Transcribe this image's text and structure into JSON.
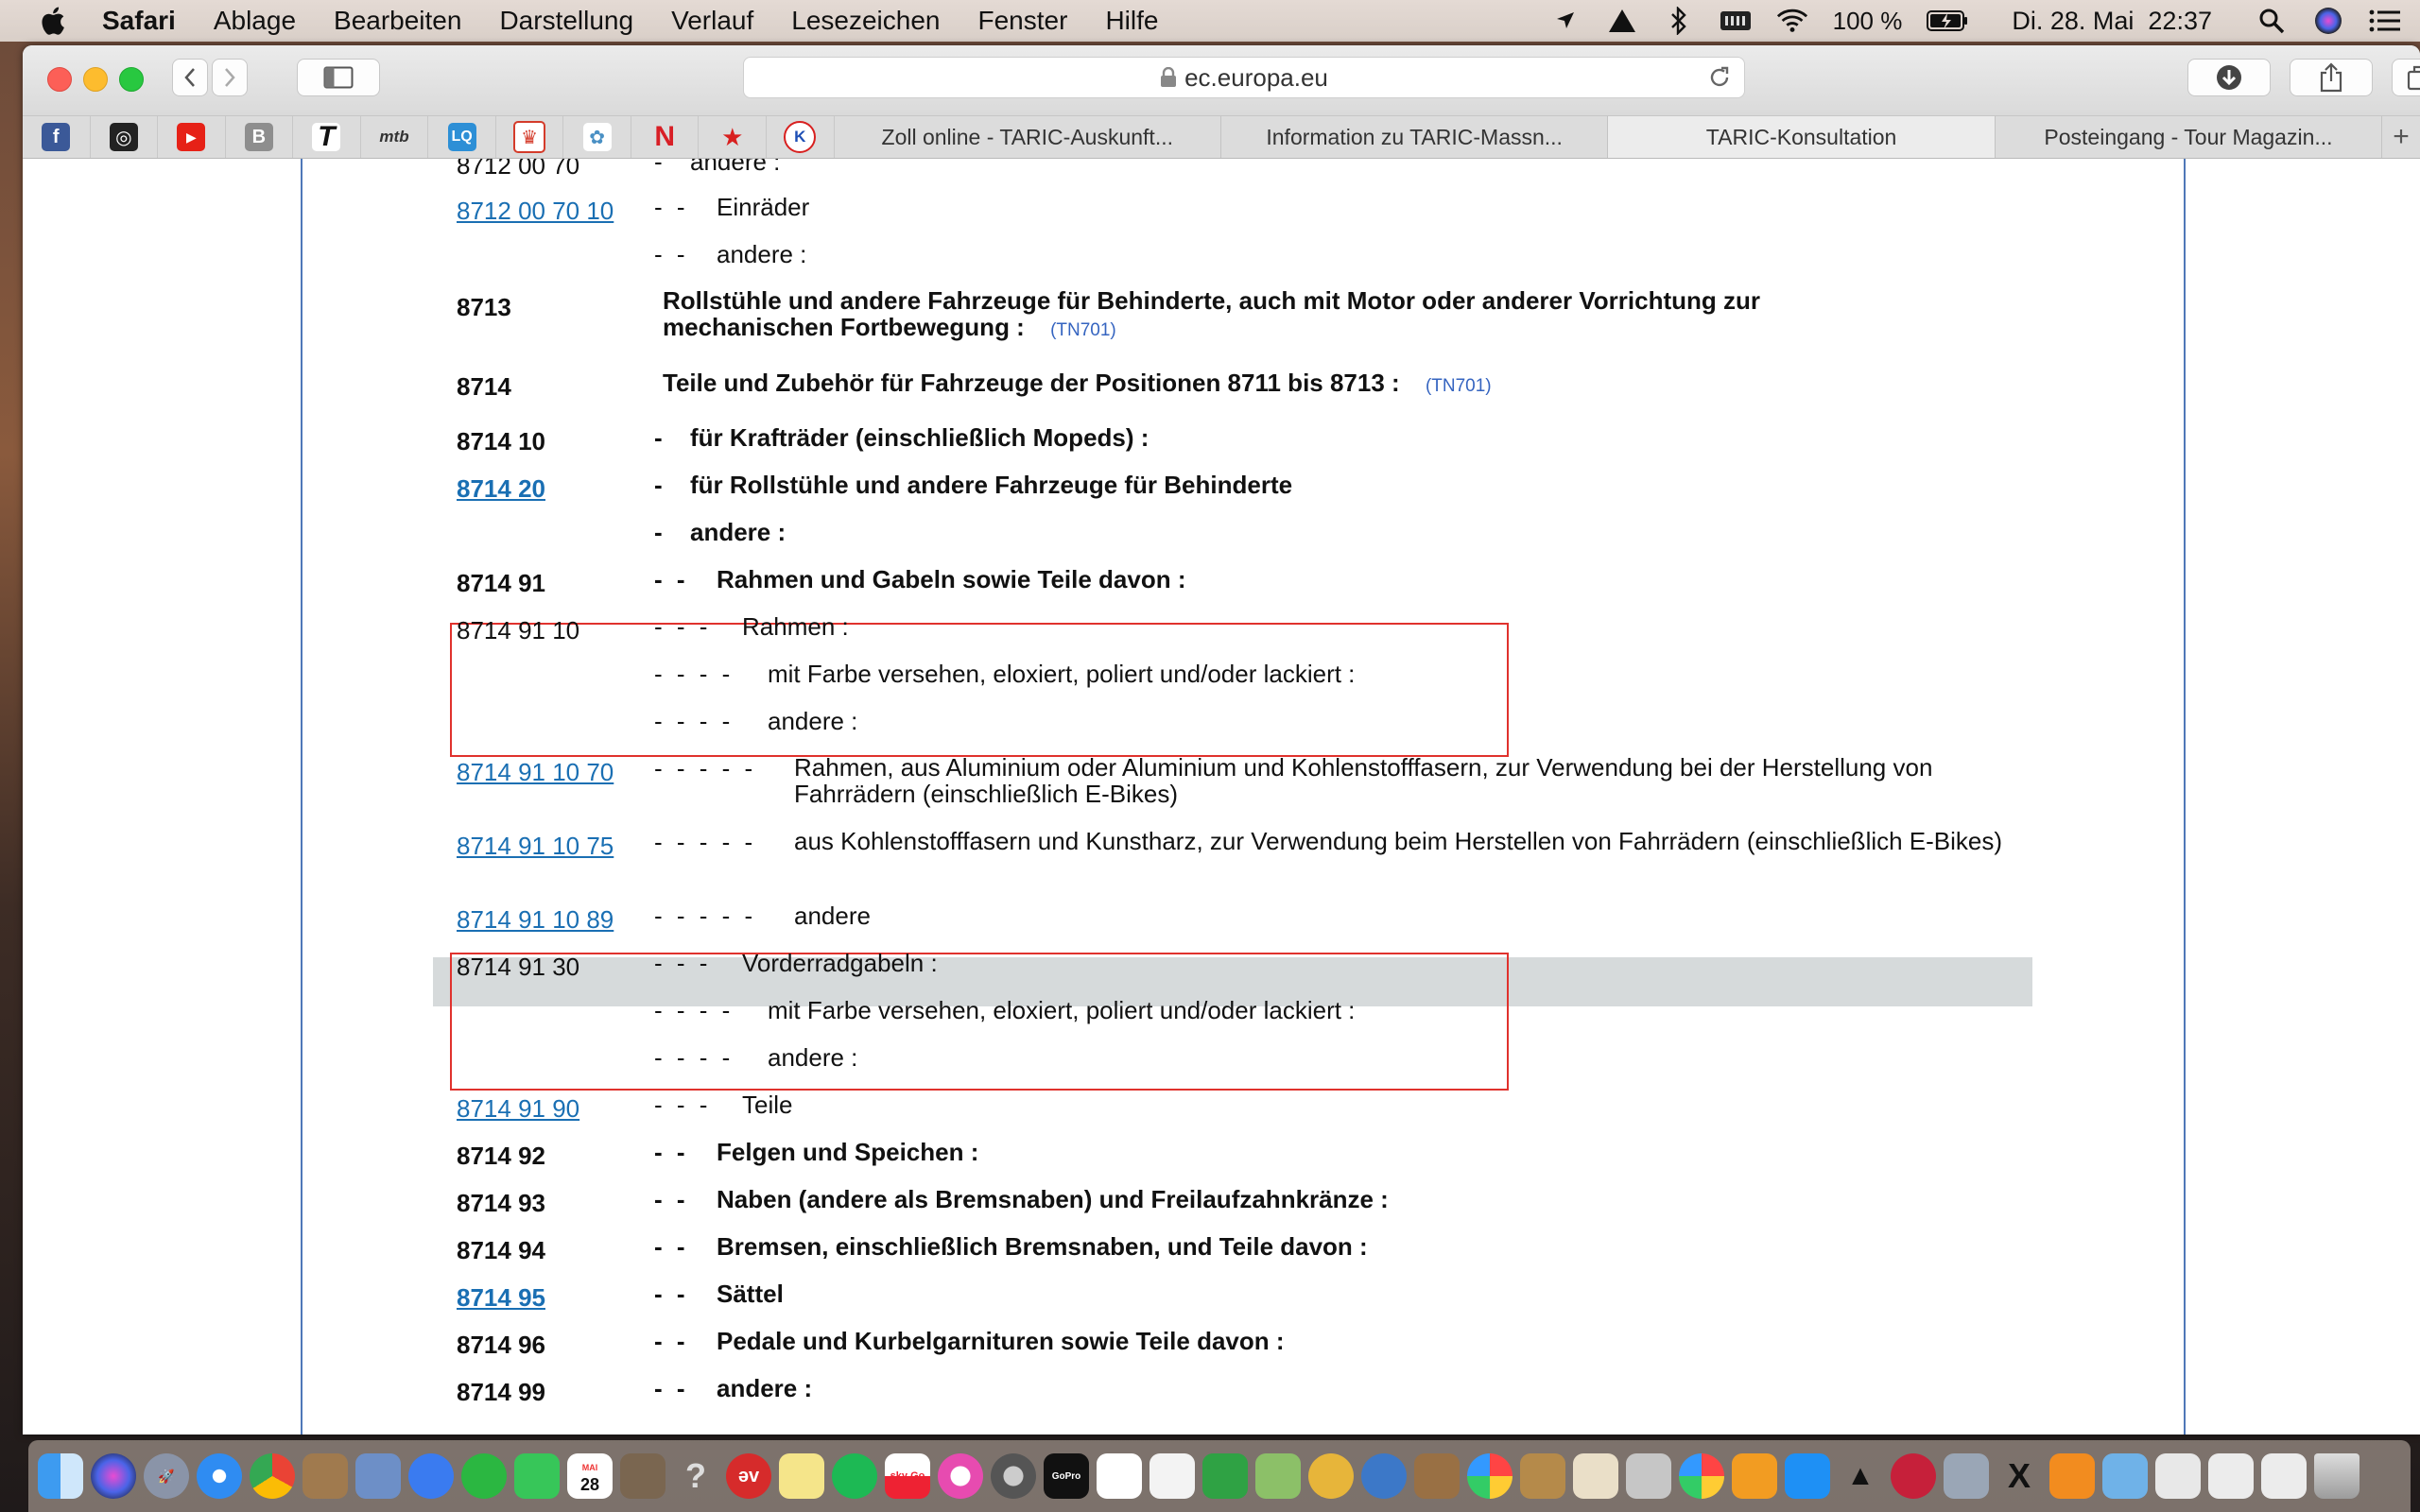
{
  "menubar": {
    "app": "Safari",
    "items": [
      "Ablage",
      "Bearbeiten",
      "Darstellung",
      "Verlauf",
      "Lesezeichen",
      "Fenster",
      "Hilfe"
    ],
    "battery": "100 %",
    "datetime": "Di. 28. Mai  22:37",
    "icons": [
      "location-icon",
      "airplay-icon",
      "bluetooth-icon",
      "memory-icon",
      "wifi-icon",
      "battery-icon",
      "spotlight-icon",
      "siri-icon",
      "notification-center-icon"
    ]
  },
  "toolbar": {
    "url": "ec.europa.eu"
  },
  "favorites": [
    {
      "name": "facebook",
      "glyph": "f",
      "color": "#3b5998"
    },
    {
      "name": "instagram",
      "glyph": "◎",
      "color": "#222222"
    },
    {
      "name": "youtube",
      "glyph": "▶",
      "color": "#e62117"
    },
    {
      "name": "b-bookmark",
      "glyph": "B",
      "color": "#8e8e8e"
    },
    {
      "name": "t-bookmark",
      "glyph": "T",
      "color": "#111111"
    },
    {
      "name": "mtb",
      "glyph": "mtb",
      "color": "#333333"
    },
    {
      "name": "lq",
      "glyph": "LQ",
      "color": "#2d8fd6"
    },
    {
      "name": "shield",
      "glyph": "♛",
      "color": "#d43b2a"
    },
    {
      "name": "seal",
      "glyph": "✿",
      "color": "#4a90c4"
    },
    {
      "name": "netflix",
      "glyph": "N",
      "color": "#d81f26"
    },
    {
      "name": "star",
      "glyph": "★",
      "color": "#d8201f"
    },
    {
      "name": "k-bookmark",
      "glyph": "K",
      "color": "#1e4fb5"
    }
  ],
  "tabs": [
    {
      "label": "Zoll online - TARIC-Auskunft...",
      "active": false
    },
    {
      "label": "Information zu TARIC-Massn...",
      "active": false
    },
    {
      "label": "TARIC-Konsultation",
      "active": true
    },
    {
      "label": "Posteingang - Tour Magazin...",
      "active": false
    }
  ],
  "taric_rows": [
    {
      "code": "8712 00 70",
      "dashes": "-",
      "desc": "andere :",
      "style": "plain",
      "link": false
    },
    {
      "code": "8712 00 70 10",
      "dashes": "- -",
      "desc": "Einräder",
      "style": "plain",
      "link": true
    },
    {
      "code": "",
      "dashes": "- -",
      "desc": "andere :",
      "style": "plain",
      "link": false
    },
    {
      "code": "8713",
      "dashes": "",
      "desc": "Rollstühle und andere Fahrzeuge für Behinderte, auch mit Motor oder anderer Vorrichtung zur mechanischen Fortbewegung :",
      "ref": "(TN701)",
      "style": "bold",
      "link": false
    },
    {
      "code": "8714",
      "dashes": "",
      "desc": "Teile und Zubehör für Fahrzeuge der Positionen 8711 bis 8713 :",
      "ref": "(TN701)",
      "style": "bold",
      "link": false
    },
    {
      "code": "8714 10",
      "dashes": "-",
      "desc": "für Krafträder (einschließlich Mopeds) :",
      "style": "bold",
      "link": false
    },
    {
      "code": "8714 20",
      "dashes": "-",
      "desc": "für Rollstühle und andere Fahrzeuge für Behinderte",
      "style": "bold",
      "link": true
    },
    {
      "code": "",
      "dashes": "-",
      "desc": "andere :",
      "style": "bold",
      "link": false
    },
    {
      "code": "8714 91",
      "dashes": "- -",
      "desc": "Rahmen und Gabeln sowie Teile davon :",
      "style": "bold",
      "link": false
    },
    {
      "code": "8714 91 10",
      "dashes": "- - -",
      "desc": "Rahmen :",
      "style": "plain",
      "link": false
    },
    {
      "code": "",
      "dashes": "- - - -",
      "desc": "mit Farbe versehen, eloxiert, poliert und/oder lackiert :",
      "style": "plain",
      "link": false
    },
    {
      "code": "",
      "dashes": "- - - -",
      "desc": "andere :",
      "style": "plain",
      "link": false
    },
    {
      "code": "8714 91 10 70",
      "dashes": "- - - - -",
      "desc": "Rahmen, aus Aluminium oder Aluminium und Kohlenstofffasern, zur Verwendung bei der Herstellung von Fahrrädern (einschließlich E-Bikes)",
      "style": "plain",
      "link": true
    },
    {
      "code": "8714 91 10 75",
      "dashes": "- - - - -",
      "desc": "aus Kohlenstofffasern und Kunstharz, zur Verwendung beim Herstellen von Fahrrädern (einschließlich E-Bikes)",
      "style": "plain",
      "link": true
    },
    {
      "code": "8714 91 10 89",
      "dashes": "- - - - -",
      "desc": "andere",
      "style": "plain",
      "link": true
    },
    {
      "code": "8714 91 30",
      "dashes": "- - -",
      "desc": "Vorderradgabeln :",
      "style": "plain",
      "link": false,
      "highlight": true
    },
    {
      "code": "",
      "dashes": "- - - -",
      "desc": "mit Farbe versehen, eloxiert, poliert und/oder lackiert :",
      "style": "plain",
      "link": false
    },
    {
      "code": "",
      "dashes": "- - - -",
      "desc": "andere :",
      "style": "plain",
      "link": false
    },
    {
      "code": "8714 91 90",
      "dashes": "- - -",
      "desc": "Teile",
      "style": "plain",
      "link": true
    },
    {
      "code": "8714 92",
      "dashes": "- -",
      "desc": "Felgen und Speichen :",
      "style": "bold",
      "link": false
    },
    {
      "code": "8714 93",
      "dashes": "- -",
      "desc": "Naben (andere als Bremsnaben) und Freilaufzahnkränze :",
      "style": "bold",
      "link": false
    },
    {
      "code": "8714 94",
      "dashes": "- -",
      "desc": "Bremsen, einschließlich Bremsnaben, und Teile davon :",
      "style": "bold",
      "link": false
    },
    {
      "code": "8714 95",
      "dashes": "- -",
      "desc": "Sättel",
      "style": "bold",
      "link": true
    },
    {
      "code": "8714 96",
      "dashes": "- -",
      "desc": "Pedale und Kurbelgarnituren sowie Teile davon :",
      "style": "bold",
      "link": false
    },
    {
      "code": "8714 99",
      "dashes": "- -",
      "desc": "andere :",
      "style": "bold",
      "link": false
    }
  ],
  "colors": {
    "link": "#1a6fb3",
    "annotation_box": "#e0322d",
    "highlight_row": "#d6dadb",
    "frame_line": "#4f78b8"
  },
  "dock": {
    "calendar_day": "28",
    "calendar_month": "MAI",
    "sky_label": "sky Go",
    "gopro_label": "GoPro",
    "apps": [
      "finder",
      "siri",
      "launchpad",
      "safari",
      "chrome",
      "notes-app",
      "preview",
      "messenger",
      "whatsapp",
      "facetime",
      "calendar",
      "installer",
      "help",
      "ev-app",
      "stickies",
      "spotify",
      "sky-go",
      "itunes",
      "system-preferences",
      "gopro",
      "reminders",
      "textedit",
      "numbers",
      "maps",
      "compass",
      "network",
      "utility",
      "photos",
      "archive",
      "files",
      "drive",
      "photos-2",
      "books",
      "app-store",
      "inkscape",
      "photo-booth",
      "image-capture",
      "x11",
      "pages",
      "folder",
      "folder-2",
      "downloads",
      "documents",
      "trash"
    ]
  }
}
